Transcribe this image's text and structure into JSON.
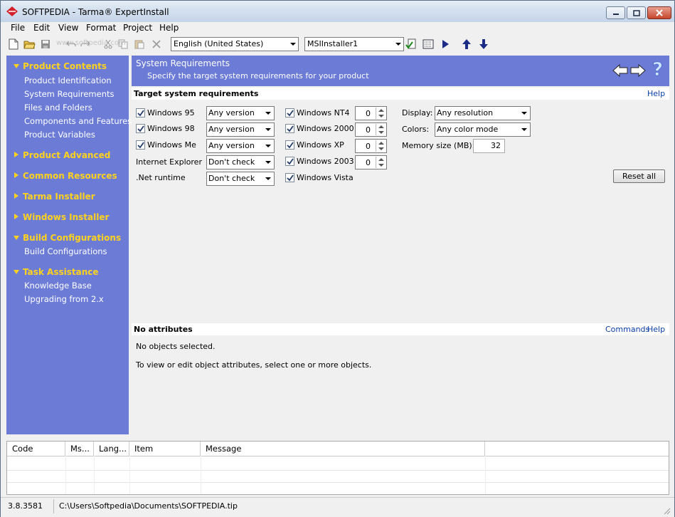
{
  "window": {
    "title": "SOFTPEDIA  - Tarma® ExpertInstall",
    "controls": [
      "minimize",
      "maximize",
      "close"
    ]
  },
  "menu": [
    "File",
    "Edit",
    "View",
    "Format",
    "Project",
    "Help"
  ],
  "toolbar": {
    "language_value": "English (United States)",
    "installer_value": "MSIInstaller1",
    "watermark": "www.softpedia.com"
  },
  "sidebar": {
    "groups": [
      {
        "label": "Product Contents",
        "expanded": true,
        "items": [
          "Product Identification",
          "System Requirements",
          "Files and Folders",
          "Components and Features",
          "Product Variables"
        ]
      },
      {
        "label": "Product Advanced",
        "expanded": false,
        "items": []
      },
      {
        "label": "Common Resources",
        "expanded": false,
        "items": []
      },
      {
        "label": "Tarma Installer",
        "expanded": false,
        "items": []
      },
      {
        "label": "Windows Installer",
        "expanded": false,
        "items": []
      },
      {
        "label": "Build Configurations",
        "expanded": true,
        "items": [
          "Build Configurations"
        ]
      },
      {
        "label": "Task Assistance",
        "expanded": true,
        "items": [
          "Knowledge Base",
          "Upgrading from 2.x"
        ]
      }
    ]
  },
  "main_header": {
    "title": "System Requirements",
    "subtitle": "Specify the target system requirements for your product"
  },
  "requirements": {
    "heading": "Target system requirements",
    "help": "Help",
    "left": [
      {
        "label": "Windows 95",
        "checked": true,
        "value": "Any version"
      },
      {
        "label": "Windows 98",
        "checked": true,
        "value": "Any version"
      },
      {
        "label": "Windows Me",
        "checked": true,
        "value": "Any version"
      },
      {
        "label": "Internet Explorer",
        "value": "Don't check"
      },
      {
        "label": ".Net runtime",
        "value": "Don't check"
      }
    ],
    "middle": [
      {
        "label": "Windows NT4",
        "checked": true,
        "value": "0"
      },
      {
        "label": "Windows 2000",
        "checked": true,
        "value": "0"
      },
      {
        "label": "Windows XP",
        "checked": true,
        "value": "0"
      },
      {
        "label": "Windows 2003",
        "checked": true,
        "value": "0"
      },
      {
        "label": "Windows Vista",
        "checked": true
      }
    ],
    "display_label": "Display:",
    "display_value": "Any resolution",
    "colors_label": "Colors:",
    "colors_value": "Any color mode",
    "memory_label": "Memory size (MB):",
    "memory_value": "32",
    "reset_button": "Reset all"
  },
  "attributes": {
    "heading": "No attributes",
    "commands": "Commands",
    "help": "Help",
    "line1": "No objects selected.",
    "line2": "To view or edit object attributes, select one or more objects."
  },
  "messages": {
    "columns": [
      "Code",
      "Ms...",
      "Lang...",
      "Item",
      "Message"
    ]
  },
  "status": {
    "version": "3.8.3581",
    "path": "C:\\Users\\Softpedia\\Documents\\SOFTPEDIA.tip"
  },
  "colors": {
    "sidebar_bg": "#6b7bd6",
    "group_label": "#ffd21e",
    "link": "#0a3fa8"
  }
}
